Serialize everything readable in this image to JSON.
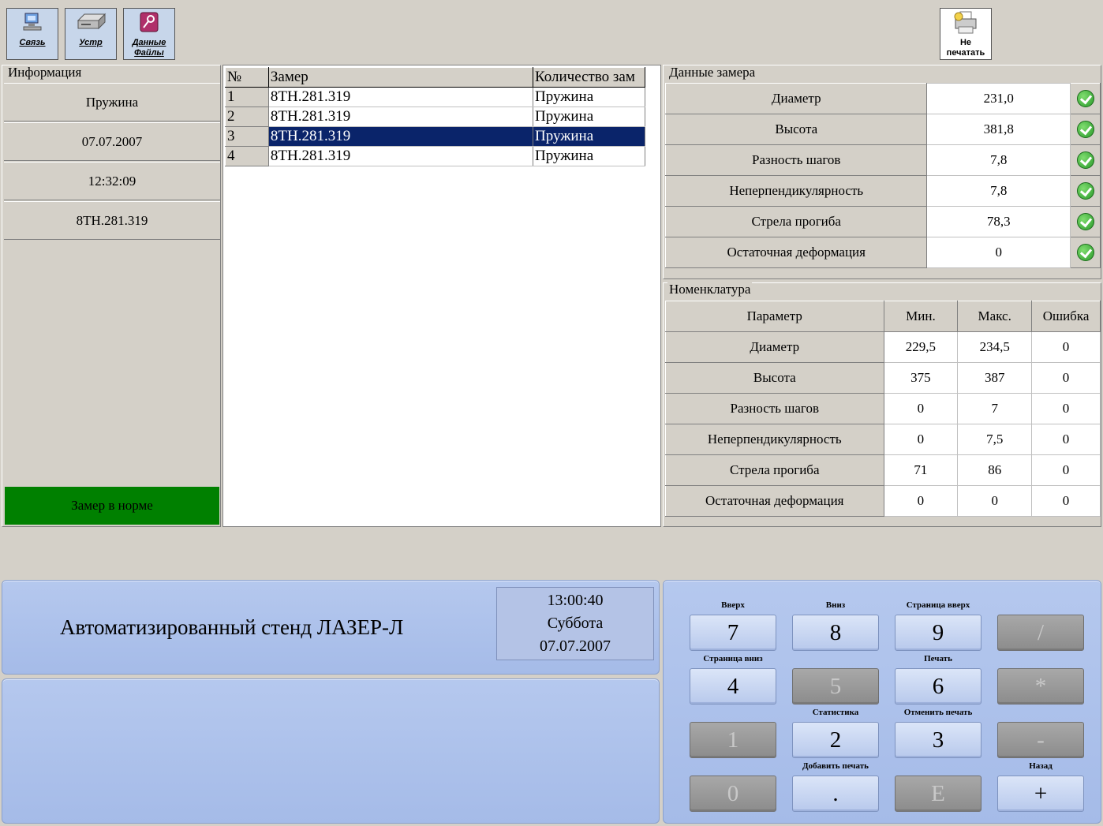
{
  "toolbar": {
    "link_label": "Связь",
    "device_label": "Устр",
    "data_files_label": "Данные Файлы",
    "no_print_label": "Не печатать"
  },
  "info": {
    "title": "Информация",
    "rows": [
      "Пружина",
      "07.07.2007",
      "12:32:09",
      "8TH.281.319"
    ],
    "status": "Замер в норме",
    "status_color": "#008000"
  },
  "list": {
    "headers": [
      "№",
      "Замер",
      "Количество зам"
    ],
    "rows": [
      {
        "n": "1",
        "name": "8TH.281.319",
        "type": "Пружина"
      },
      {
        "n": "2",
        "name": "8TH.281.319",
        "type": "Пружина"
      },
      {
        "n": "3",
        "name": "8TH.281.319",
        "type": "Пружина"
      },
      {
        "n": "4",
        "name": "8TH.281.319",
        "type": "Пружина"
      }
    ],
    "selected_row": 3,
    "selection_color": "#0a246a"
  },
  "measurement": {
    "title": "Данные замера",
    "rows": [
      {
        "label": "Диаметр",
        "value": "231,0"
      },
      {
        "label": "Высота",
        "value": "381,8"
      },
      {
        "label": "Разность шагов",
        "value": "7,8"
      },
      {
        "label": "Неперпендикулярность",
        "value": "7,8"
      },
      {
        "label": "Стрела прогиба",
        "value": "78,3"
      },
      {
        "label": "Остаточная деформация",
        "value": "0"
      }
    ],
    "status_icon": "check-ok-icon"
  },
  "nomenclature": {
    "title": "Номенклатура",
    "headers": [
      "Параметр",
      "Мин.",
      "Макс.",
      "Ошибка"
    ],
    "rows": [
      {
        "param": "Диаметр",
        "min": "229,5",
        "max": "234,5",
        "err": "0"
      },
      {
        "param": "Высота",
        "min": "375",
        "max": "387",
        "err": "0"
      },
      {
        "param": "Разность шагов",
        "min": "0",
        "max": "7",
        "err": "0"
      },
      {
        "param": "Неперпендикулярность",
        "min": "0",
        "max": "7,5",
        "err": "0"
      },
      {
        "param": "Стрела прогиба",
        "min": "71",
        "max": "86",
        "err": "0"
      },
      {
        "param": "Остаточная деформация",
        "min": "0",
        "max": "0",
        "err": "0"
      }
    ]
  },
  "footer": {
    "title": "Автоматизированный стенд ЛАЗЕР-Л",
    "time": "13:00:40",
    "weekday": "Суббота",
    "date": "07.07.2007"
  },
  "keypad": {
    "keys": [
      "7",
      "8",
      "9",
      "/",
      "4",
      "5",
      "6",
      "*",
      "1",
      "2",
      "3",
      "-",
      "0",
      ".",
      "E",
      "+"
    ],
    "labels": {
      "up": "Вверх",
      "down": "Вниз",
      "page_up": "Страница вверх",
      "page_down": "Страница вниз",
      "print": "Печать",
      "statistics": "Статистика",
      "cancel_print": "Отменить печать",
      "add_print": "Добавить печать",
      "back": "Назад"
    }
  }
}
